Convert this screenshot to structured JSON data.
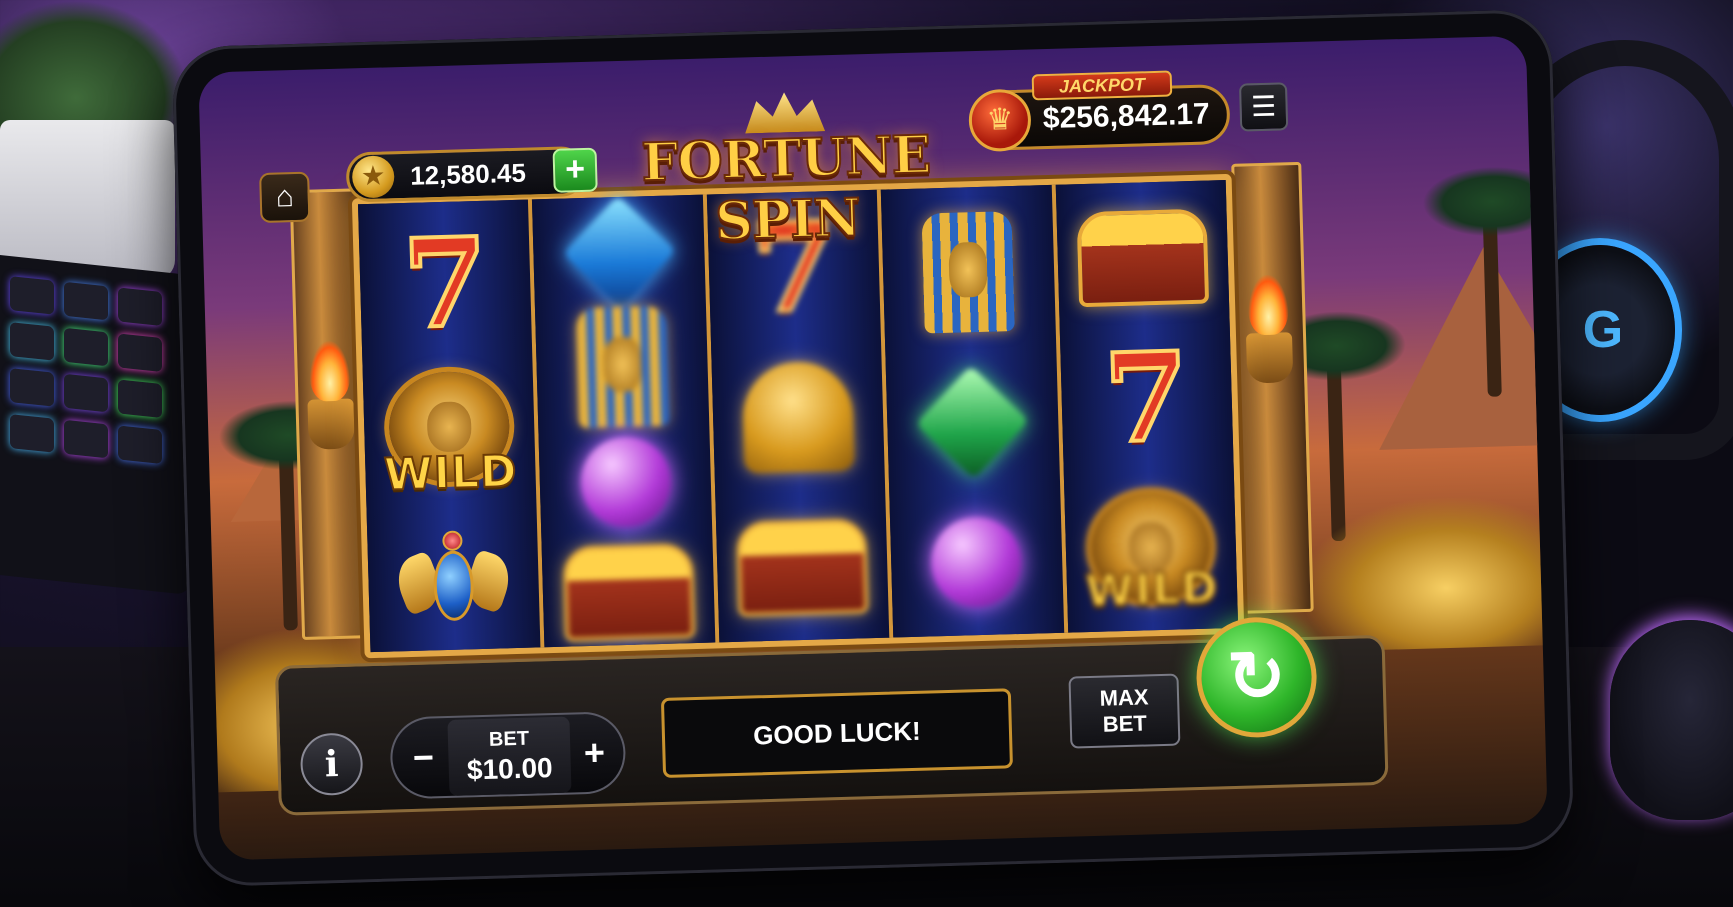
{
  "game": {
    "title": "FORTUNE SPIN",
    "balance": "12,580.45",
    "jackpot_tag": "JACKPOT",
    "jackpot_value": "$256,842.17",
    "bet_label": "BET",
    "bet_value": "$10.00",
    "message": "GOOD LUCK!",
    "max_bet_label": [
      "MAX",
      "BET"
    ],
    "wild_label": "WILD"
  },
  "icons": {
    "home": "home-icon",
    "coin": "coin-icon",
    "add": "plus-icon",
    "menu": "hamburger-icon",
    "info": "info-icon",
    "spin": "refresh-icon"
  },
  "glyphs": {
    "home": "⌂",
    "coin": "★",
    "add": "+",
    "menu": "☰",
    "info": "i",
    "minus": "−",
    "plus": "+",
    "spin": "↻",
    "jackpot": "♛",
    "seven": "7"
  },
  "reels": [
    [
      "seven",
      "lion-wild",
      "scarab"
    ],
    [
      "gem-blue",
      "pharaoh",
      "gem-purple",
      "chest"
    ],
    [
      "seven",
      "bell",
      "chest"
    ],
    [
      "pharaoh",
      "gem-green",
      "gem-purple"
    ],
    [
      "chest",
      "seven",
      "lion-wild"
    ]
  ],
  "colors": {
    "accent_gold": "#e4a847",
    "spin_green": "#2fb62a",
    "jackpot_red": "#d43a1a",
    "reel_blue": "#1d2d8a"
  }
}
